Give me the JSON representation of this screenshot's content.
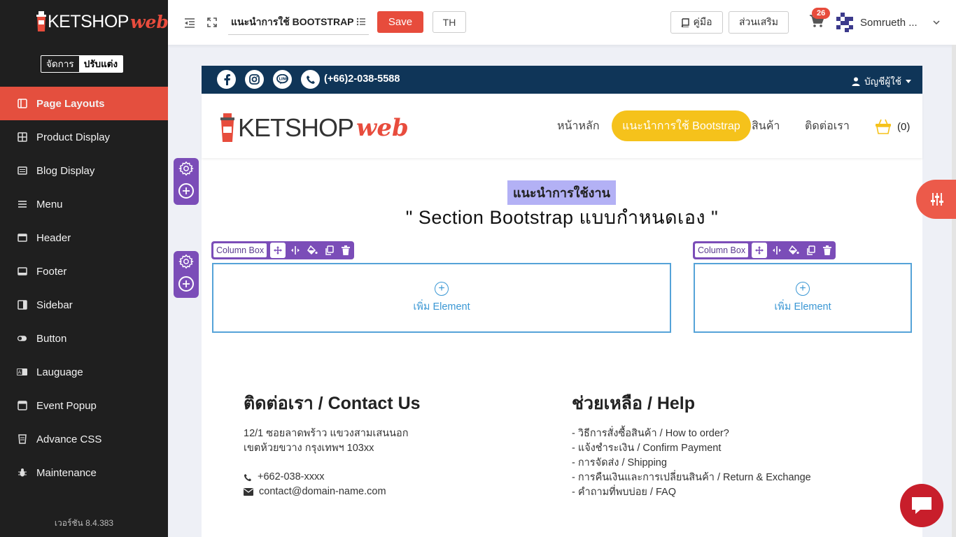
{
  "sidebar": {
    "logo_main": "KETSHOP",
    "logo_sub": "web",
    "mode_manage": "จัดการ",
    "mode_customize": "ปรับแต่ง",
    "items": [
      {
        "label": "Page Layouts",
        "icon": "layout-icon"
      },
      {
        "label": "Product Display",
        "icon": "grid-icon"
      },
      {
        "label": "Blog Display",
        "icon": "list-icon"
      },
      {
        "label": "Menu",
        "icon": "menu-icon"
      },
      {
        "label": "Header",
        "icon": "window-icon"
      },
      {
        "label": "Footer",
        "icon": "window-bottom-icon"
      },
      {
        "label": "Sidebar",
        "icon": "sidebar-icon"
      },
      {
        "label": "Button",
        "icon": "toggle-icon"
      },
      {
        "label": "Lauguage",
        "icon": "language-icon"
      },
      {
        "label": "Event Popup",
        "icon": "popup-icon"
      },
      {
        "label": "Advance CSS",
        "icon": "css-icon"
      },
      {
        "label": "Maintenance",
        "icon": "bug-icon"
      }
    ],
    "version": "เวอร์ชัน 8.4.383"
  },
  "topbar": {
    "page_name": "แนะนำการใช้ BOOTSTRAP",
    "save_label": "Save",
    "lang_label": "TH",
    "manual_label": "คู่มือ",
    "addon_label": "ส่วนเสริม",
    "cart_badge": "26",
    "user_name": "Somrueth ..."
  },
  "site": {
    "phone": "(+66)2-038-5588",
    "account": "บัญชีผู้ใช้",
    "logo_main": "KETSHOP",
    "logo_sub": "web",
    "nav": [
      "หน้าหลัก",
      "แนะนำการใช้ Bootstrap",
      "สินค้า",
      "ติดต่อเรา"
    ],
    "cart_count": "(0)"
  },
  "section": {
    "label": "แนะนำการใช้งาน",
    "title": "\" Section Bootstrap แบบกำหนดเอง \"",
    "columns": [
      {
        "toolbar_label": "Column Box",
        "add_label": "เพิ่ม Element"
      },
      {
        "toolbar_label": "Column Box",
        "add_label": "เพิ่ม Element"
      }
    ]
  },
  "footer": {
    "contact_title": "ติดต่อเรา / Contact Us",
    "address_line1": "12/1 ซอยลาดพร้าว แขวงสามเสนนอก",
    "address_line2": "เขตห้วยขวาง กรุงเทพฯ 103xx",
    "phone": "+662-038-xxxx",
    "email": "contact@domain-name.com",
    "help_title": "ช่วยเหลือ / Help",
    "help_links": [
      "- วิธีการสั่งซื้อสินค้า / How to order?",
      "- แจ้งชำระเงิน / Confirm Payment",
      "- การจัดส่ง / Shipping",
      "- การคืนเงินและการเปลี่ยนสินค้า / Return & Exchange",
      "- คำถามที่พบบ่อย / FAQ"
    ]
  },
  "colors": {
    "accent_red": "#e74c3c",
    "sidebar_bg": "#1f1f1f",
    "topstrip_bg": "#0f3558",
    "pill_yellow": "#f5c21b",
    "builder_purple": "#7b4db8",
    "column_blue": "#55a3d8"
  }
}
